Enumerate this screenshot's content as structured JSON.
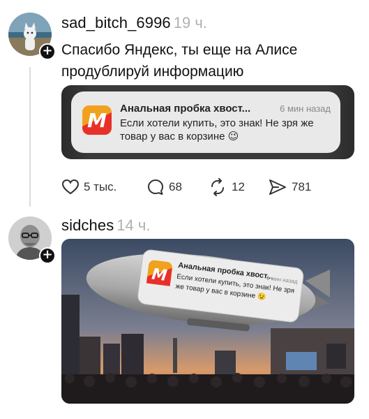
{
  "posts": [
    {
      "username": "sad_bitch_6996",
      "time": "19 ч.",
      "text": "Спасибо Яндекс, ты еще на Алисе продублируй информацию",
      "notification": {
        "title": "Анальная пробка хвост...",
        "time": "6 мин назад",
        "body": "Если хотели купить, это знак! Не зря же товар у вас в корзине 😉",
        "app_icon": "yandex-market-icon",
        "app_color": "#f0a21e"
      },
      "stats": {
        "likes": "5 тыс.",
        "comments": "68",
        "reposts": "12",
        "shares": "781"
      }
    },
    {
      "username": "sidches",
      "time": "14 ч.",
      "image": {
        "notification_title": "Анальная пробка хвост...",
        "notification_time": "6 мин назад",
        "notification_body_line1": "Если хотели купить, это знак! Не зря",
        "notification_body_line2": "же товар у вас в корзине 😉"
      }
    }
  ]
}
